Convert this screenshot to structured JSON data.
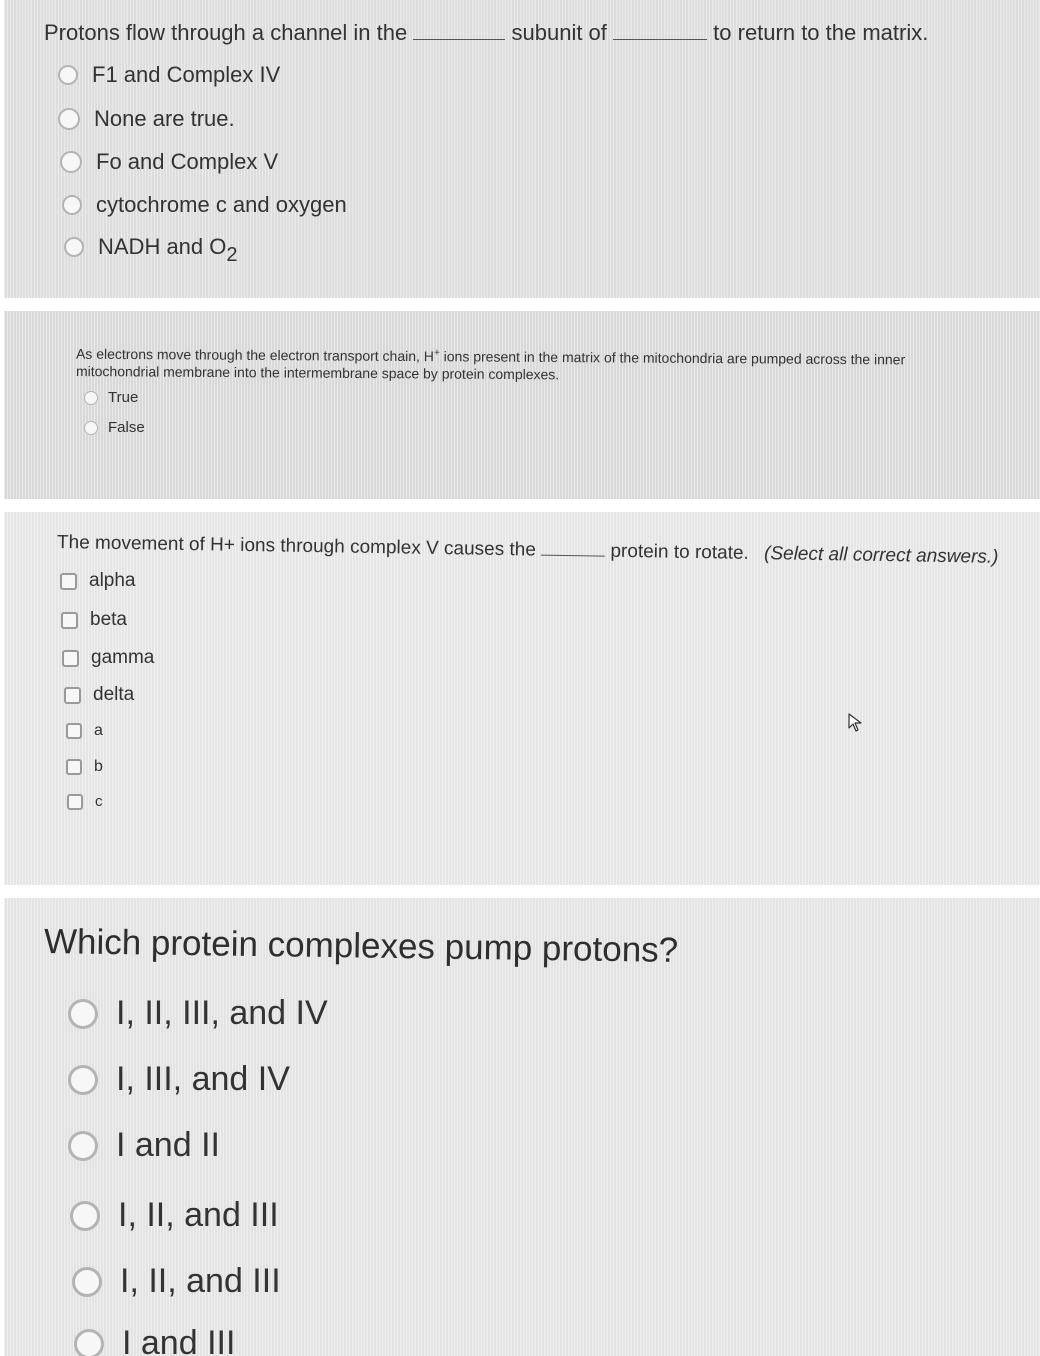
{
  "q1": {
    "text_before": "Protons flow through a channel in the",
    "text_middle": "subunit of",
    "text_after": "to return to the matrix.",
    "options": [
      "F1 and Complex IV",
      "None are true.",
      "Fo and Complex V",
      "cytochrome c and oxygen",
      "NADH and O",
      "2"
    ]
  },
  "q2": {
    "line1_a": "As electrons move through the electron transport chain, H",
    "line1_sup": "+",
    "line1_b": "ions present in the matrix of the mitochondria are pumped across the inner",
    "line2": "mitochondrial membrane into the intermembrane space by protein complexes.",
    "options": [
      "True",
      "False"
    ]
  },
  "q3": {
    "text_before": "The movement of H+ ions through complex V causes the",
    "text_after": "protein to rotate.",
    "instruction": "(Select all correct answers.)",
    "options": [
      "alpha",
      "beta",
      "gamma",
      "delta",
      "a",
      "b",
      "c"
    ]
  },
  "q4": {
    "text": "Which protein complexes pump protons?",
    "options": [
      "I, II, III, and IV",
      "I, III, and IV",
      "I and II",
      "I, II, and III",
      "I, II, and III",
      "I and III"
    ]
  },
  "colors": {
    "radio_border": "#b4b4b4",
    "checkbox_border": "#9a9a9a",
    "text": "#333333"
  },
  "icons": [
    "arrow-cursor-icon"
  ]
}
